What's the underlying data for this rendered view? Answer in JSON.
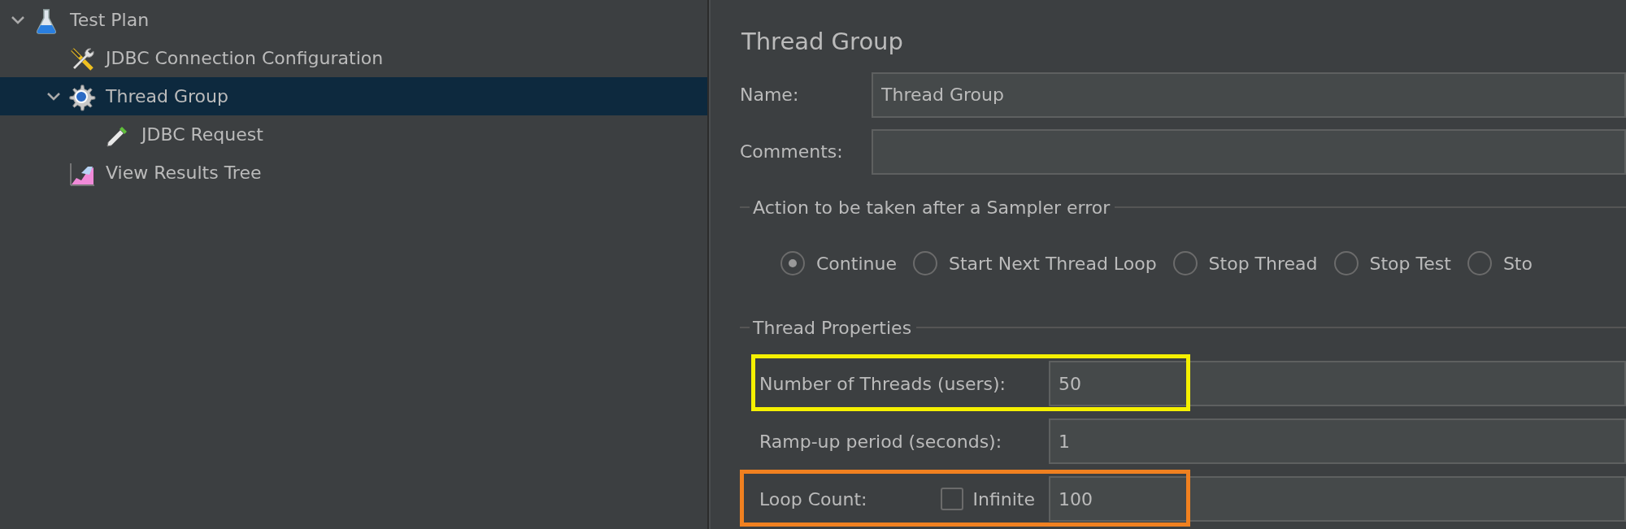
{
  "tree": [
    {
      "label": "Test Plan",
      "kind": "test-plan",
      "selected": false,
      "expanded": true,
      "children": [
        {
          "label": "JDBC Connection Configuration",
          "kind": "config",
          "selected": false
        },
        {
          "label": "Thread Group",
          "kind": "thread-group",
          "selected": true,
          "expanded": true,
          "children": [
            {
              "label": "JDBC Request",
              "kind": "sampler",
              "selected": false
            }
          ]
        },
        {
          "label": "View Results Tree",
          "kind": "listener",
          "selected": false
        }
      ]
    }
  ],
  "panel": {
    "title": "Thread Group",
    "fields": [
      {
        "label": "Name:",
        "value": "Thread Group"
      },
      {
        "label": "Comments:"
      }
    ],
    "error_action": {
      "legend": "Action to be taken after a Sampler error",
      "options": [
        {
          "label": "Continue",
          "selected": true
        },
        {
          "label": "Start Next Thread Loop",
          "selected": false
        },
        {
          "label": "Stop Thread",
          "selected": false
        },
        {
          "label": "Stop Test",
          "selected": false
        },
        {
          "label": "Sto",
          "selected": false
        }
      ]
    },
    "thread_properties": {
      "legend": "Thread Properties",
      "rows": [
        {
          "kind": "text",
          "label": "Number of Threads (users):",
          "value": "50",
          "color": "#f5f000"
        },
        {
          "kind": "text",
          "label": "Ramp-up period (seconds):",
          "value": "1"
        },
        {
          "kind": "loop",
          "label": "Loop Count:",
          "checkbox_label": "Infinite",
          "checked": false,
          "value": "100",
          "color": "#f08020"
        }
      ]
    }
  }
}
